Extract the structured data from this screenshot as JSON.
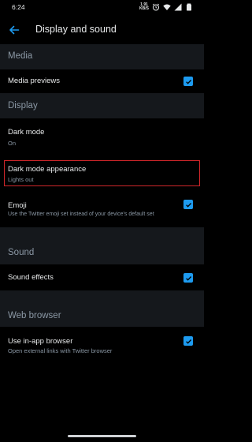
{
  "status_bar": {
    "time": "6:24",
    "speed_value": "1.91",
    "speed_unit": "KB/S",
    "icons": [
      "alarm-icon",
      "wifi-icon",
      "signal-icon",
      "battery-icon"
    ]
  },
  "app_bar": {
    "back_icon": "back-arrow-icon",
    "title": "Display and sound"
  },
  "accent_color": "#1d9bf0",
  "sections": {
    "media": {
      "header": "Media",
      "media_previews": {
        "title": "Media previews",
        "checked": true
      }
    },
    "display": {
      "header": "Display",
      "dark_mode": {
        "title": "Dark mode",
        "value": "On"
      },
      "dark_mode_appearance": {
        "title": "Dark mode appearance",
        "value": "Lights out",
        "highlight_color": "#d0262a"
      },
      "emoji": {
        "title": "Emoji",
        "description": "Use the Twitter emoji set instead of your device's default set",
        "checked": true
      }
    },
    "sound": {
      "header": "Sound",
      "sound_effects": {
        "title": "Sound effects",
        "checked": true
      }
    },
    "web_browser": {
      "header": "Web browser",
      "in_app_browser": {
        "title": "Use in-app browser",
        "description": "Open external links with Twitter browser",
        "checked": true
      }
    }
  }
}
